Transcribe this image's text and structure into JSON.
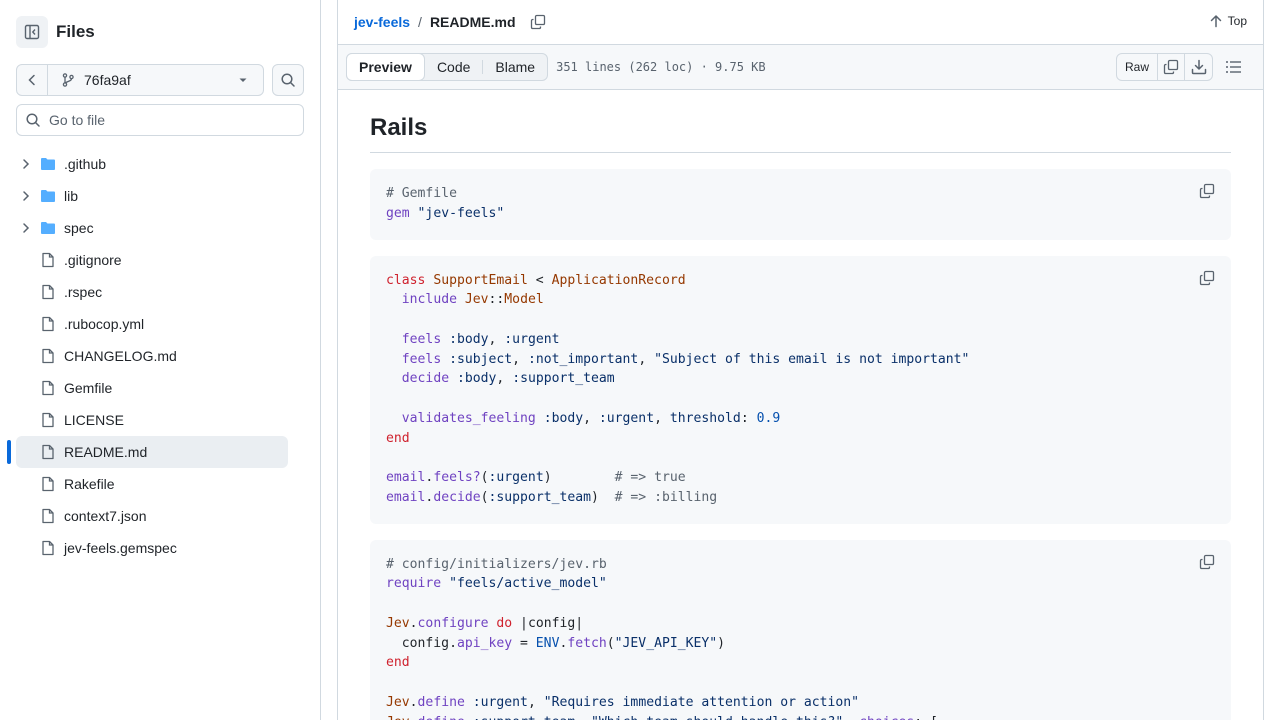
{
  "sidebar": {
    "title": "Files",
    "branch": "76fa9af",
    "goto_placeholder": "Go to file",
    "tree": [
      {
        "name": ".github",
        "type": "folder"
      },
      {
        "name": "lib",
        "type": "folder"
      },
      {
        "name": "spec",
        "type": "folder"
      },
      {
        "name": ".gitignore",
        "type": "file"
      },
      {
        "name": ".rspec",
        "type": "file"
      },
      {
        "name": ".rubocop.yml",
        "type": "file"
      },
      {
        "name": "CHANGELOG.md",
        "type": "file"
      },
      {
        "name": "Gemfile",
        "type": "file"
      },
      {
        "name": "LICENSE",
        "type": "file"
      },
      {
        "name": "README.md",
        "type": "file",
        "selected": true
      },
      {
        "name": "Rakefile",
        "type": "file"
      },
      {
        "name": "context7.json",
        "type": "file"
      },
      {
        "name": "jev-feels.gemspec",
        "type": "file"
      }
    ]
  },
  "breadcrumb": {
    "repo": "jev-feels",
    "separator": "/",
    "file": "README.md"
  },
  "top_link": "Top",
  "filebar": {
    "tabs": [
      "Preview",
      "Code",
      "Blame"
    ],
    "active_tab": "Preview",
    "info": "351 lines (262 loc) · 9.75 KB",
    "raw_label": "Raw"
  },
  "content": {
    "heading": "Rails",
    "code_blocks": [
      "# Gemfile\ngem \"jev-feels\"",
      "class SupportEmail < ApplicationRecord\n  include Jev::Model\n\n  feels :body, :urgent\n  feels :subject, :not_important, \"Subject of this email is not important\"\n  decide :body, :support_team\n\n  validates_feeling :body, :urgent, threshold: 0.9\nend\n\nemail.feels?(:urgent)        # => true\nemail.decide(:support_team)  # => :billing",
      "# config/initializers/jev.rb\nrequire \"feels/active_model\"\n\nJev.configure do |config|\n  config.api_key = ENV.fetch(\"JEV_API_KEY\")\nend\n\nJev.define :urgent, \"Requires immediate attention or action\"\nJev.define :support_team, \"Which team should handle this?\", choices: ["
    ]
  },
  "colors": {
    "accent": "#0969da",
    "folder": "#54aeff",
    "border": "#d1d9e0"
  }
}
